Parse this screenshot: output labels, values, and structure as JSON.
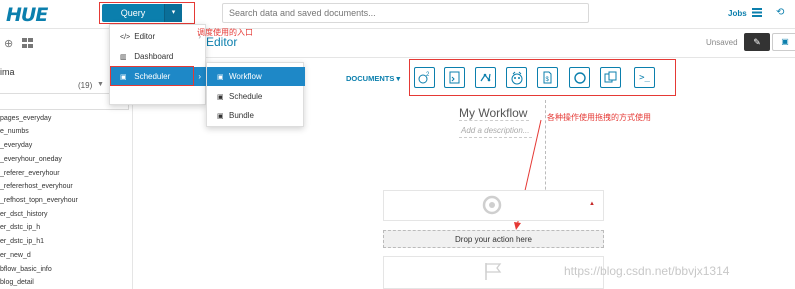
{
  "header": {
    "logo": "HUE",
    "query_label": "Query",
    "query_caret": "▾",
    "search_placeholder": "Search data and saved documents...",
    "jobs_label": "Jobs",
    "history_icon": "undo-icon"
  },
  "sidebar": {
    "db_name": "ima",
    "table_count": "(19)",
    "tables": [
      "pages_everyday",
      "e_numbs",
      "_everyday",
      "_everyhour_oneday",
      "_referer_everyhour",
      "_refererhost_everyhour",
      "_refhost_topn_everyhour",
      "er_dsct_history",
      "er_dstc_ip_h",
      "er_dstc_ip_h1",
      "er_new_d",
      "bflow_basic_info",
      "blog_detail"
    ]
  },
  "menu": {
    "items": [
      {
        "label": "Editor",
        "icon": "code-icon",
        "has_submenu": true
      },
      {
        "label": "Dashboard",
        "icon": "bar-chart-icon",
        "has_submenu": false
      },
      {
        "label": "Scheduler",
        "icon": "calendar-icon",
        "has_submenu": true
      }
    ],
    "submenu": [
      {
        "label": "Workflow",
        "icon": "calendar-icon"
      },
      {
        "label": "Schedule",
        "icon": "calendar-icon"
      },
      {
        "label": "Bundle",
        "icon": "calendar-icon"
      }
    ]
  },
  "annotations": {
    "scheduler_entry": "调度使用的入口",
    "drag_usage": "各种操作使用拖拽的方式使用"
  },
  "editor": {
    "title": "Editor",
    "unsaved": "Unsaved",
    "documents_label": "DOCUMENTS",
    "workflow_name": "My Workflow",
    "description_placeholder": "Add a description...",
    "drop_text": "Drop your action here",
    "actions": [
      "hive-icon",
      "sql-file-icon",
      "graph-icon",
      "sqoop-icon",
      "document-icon",
      "spark-icon",
      "copy-icon",
      "shell-icon"
    ]
  },
  "watermark": "https://blog.csdn.net/bbvjx1314",
  "colors": {
    "accent": "#0b7fad",
    "highlight": "#1e88c7",
    "annotation": "#e53935"
  }
}
